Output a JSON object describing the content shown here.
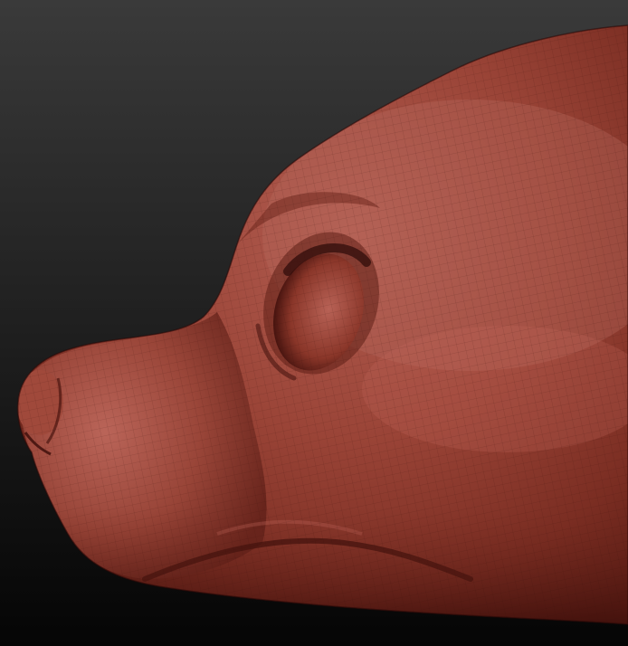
{
  "scene": {
    "subject": "sculpted-animal-head-profile",
    "view": "side",
    "colors": {
      "background_top": "#3a3a3a",
      "background_bottom": "#050505",
      "material_base": "#8e3b2f",
      "material_light": "#c2685b",
      "material_shadow": "#4a1510",
      "material_deep": "#2a0807"
    }
  }
}
